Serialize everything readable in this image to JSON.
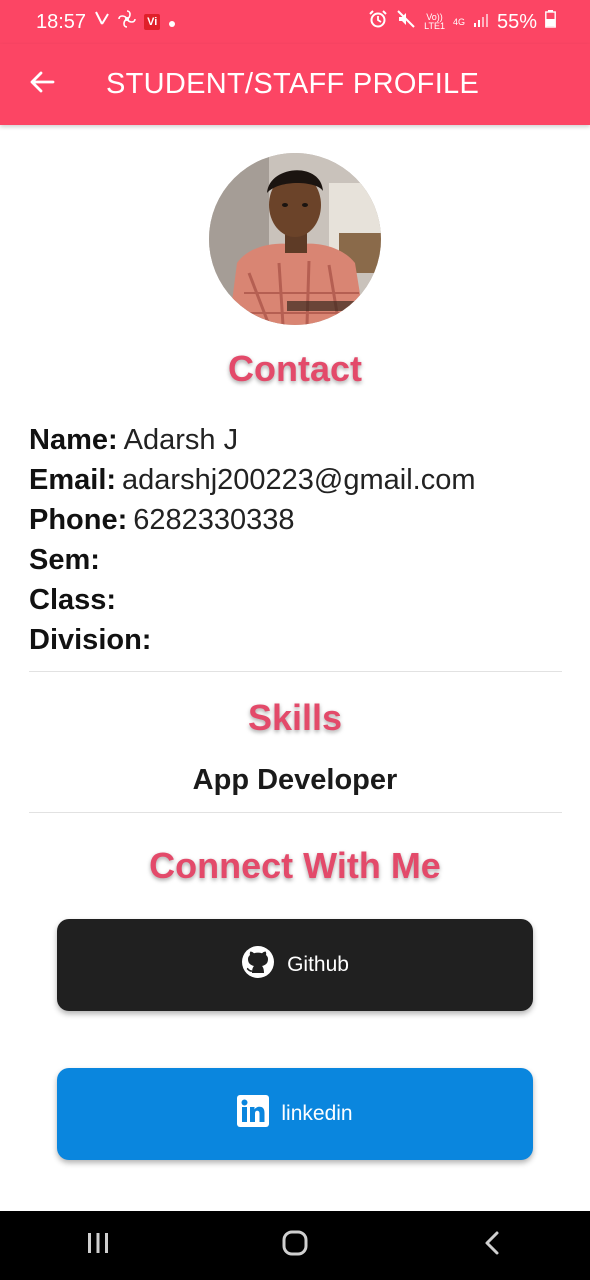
{
  "status_bar": {
    "time": "18:57",
    "carrier_badge": "Vi",
    "volte_top": "Vo))",
    "volte_bottom": "LTE1",
    "network": "4G",
    "battery": "55%"
  },
  "app_bar": {
    "title": "STUDENT/STAFF PROFILE",
    "back_icon": "arrow-left-icon"
  },
  "colors": {
    "primary": "#fc4564",
    "heading": "#e34a6a",
    "github": "#202020",
    "linkedin": "#0a86de"
  },
  "contact": {
    "heading": "Contact",
    "fields": [
      {
        "label": "Name:",
        "value": "Adarsh J"
      },
      {
        "label": "Email:",
        "value": "adarshj200223@gmail.com"
      },
      {
        "label": "Phone:",
        "value": "6282330338"
      },
      {
        "label": "Sem:",
        "value": ""
      },
      {
        "label": "Class:",
        "value": ""
      },
      {
        "label": "Division:",
        "value": ""
      }
    ]
  },
  "skills": {
    "heading": "Skills",
    "items": [
      "App Developer"
    ]
  },
  "connect": {
    "heading": "Connect With Me",
    "github": {
      "label": "Github",
      "icon": "github-icon"
    },
    "linkedin": {
      "label": "linkedin",
      "icon": "linkedin-icon"
    }
  },
  "nav_bar": {
    "icons": [
      "recent-apps-icon",
      "home-icon",
      "back-icon"
    ]
  }
}
